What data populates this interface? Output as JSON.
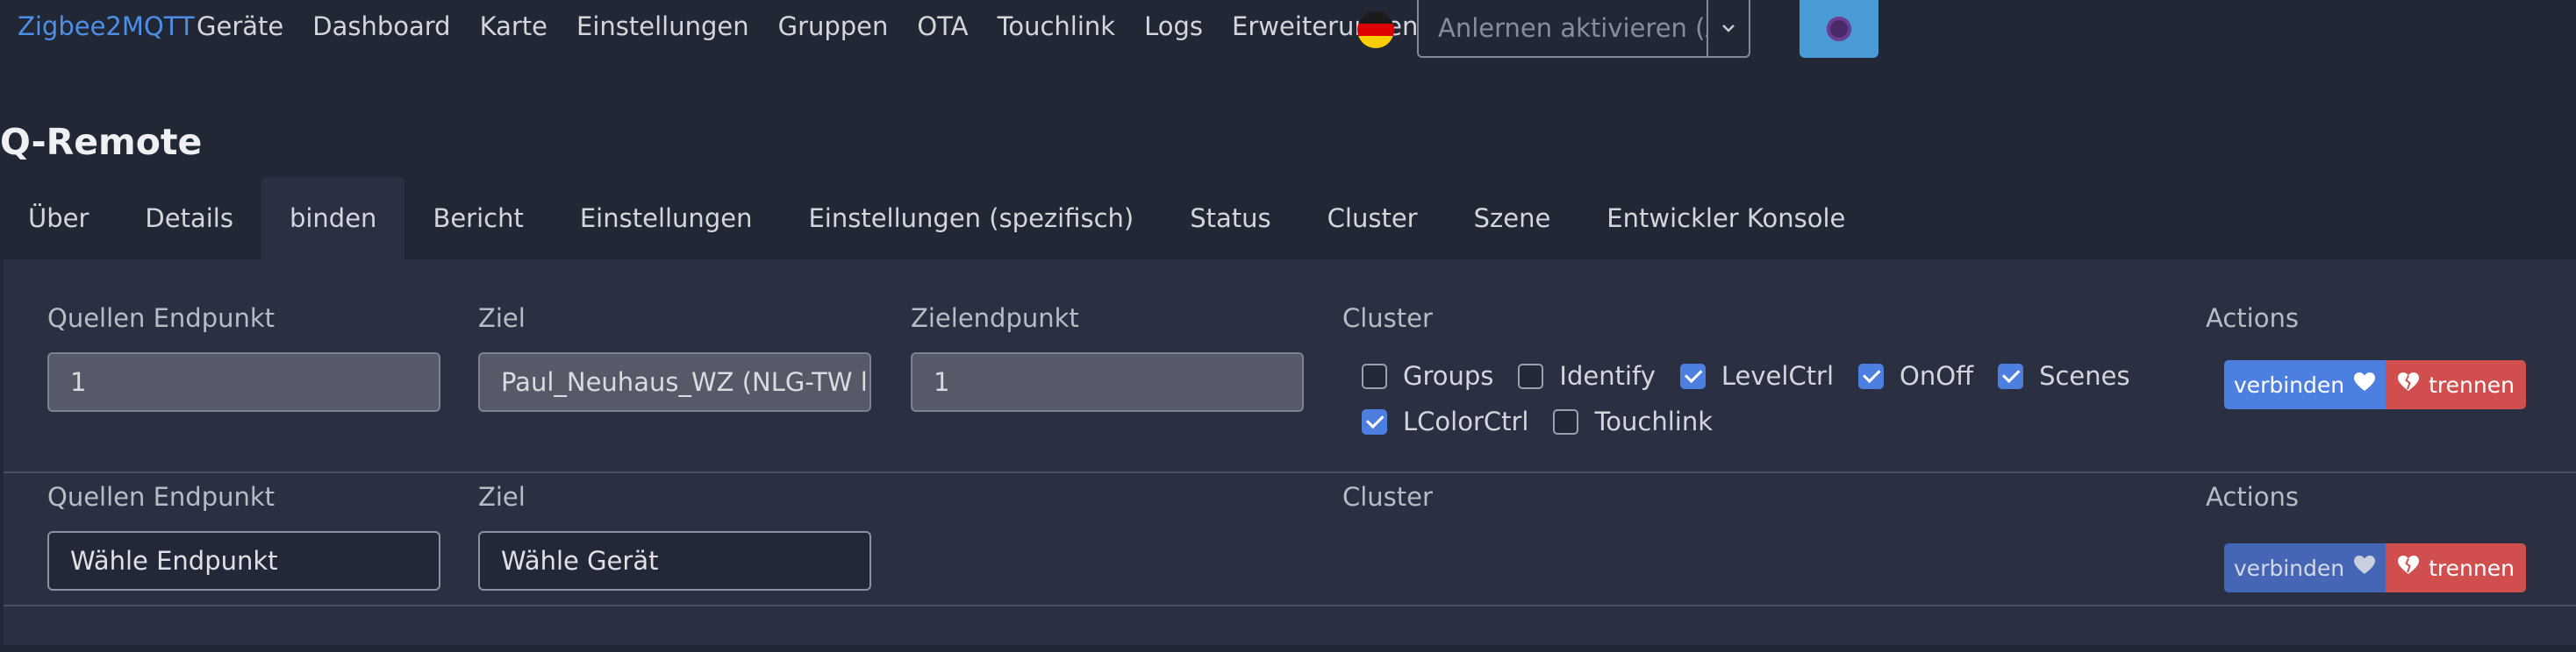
{
  "navbar": {
    "brand": "Zigbee2MQTT",
    "items": [
      "Geräte",
      "Dashboard",
      "Karte",
      "Einstellungen",
      "Gruppen",
      "OTA",
      "Touchlink",
      "Logs",
      "Erweiterungen"
    ],
    "permit_join": "Anlernen aktivieren (Alle)"
  },
  "page": {
    "title": "Q-Remote"
  },
  "tabs": [
    "Über",
    "Details",
    "binden",
    "Bericht",
    "Einstellungen",
    "Einstellungen (spezifisch)",
    "Status",
    "Cluster",
    "Szene",
    "Entwickler Konsole"
  ],
  "active_tab": "binden",
  "labels": {
    "source_endpoint": "Quellen Endpunkt",
    "target": "Ziel",
    "target_endpoint": "Zielendpunkt",
    "cluster": "Cluster",
    "actions": "Actions"
  },
  "buttons": {
    "bind": "verbinden",
    "unbind": "trennen"
  },
  "rows": [
    {
      "source_endpoint": "1",
      "target": "Paul_Neuhaus_WZ (NLG-TW light)",
      "target_endpoint": "1",
      "clusters": [
        {
          "name": "Groups",
          "checked": false
        },
        {
          "name": "Identify",
          "checked": false
        },
        {
          "name": "LevelCtrl",
          "checked": true
        },
        {
          "name": "OnOff",
          "checked": true
        },
        {
          "name": "Scenes",
          "checked": true
        },
        {
          "name": "LColorCtrl",
          "checked": true
        },
        {
          "name": "Touchlink",
          "checked": false
        }
      ]
    },
    {
      "source_endpoint": "Wähle Endpunkt",
      "target": "Wähle Gerät"
    }
  ],
  "colors": {
    "background": "#222736",
    "panel": "#2a2f41",
    "brand": "#4d8fe7",
    "primary": "#4d7fe0",
    "danger": "#d14e4e",
    "info": "#4a9ad6"
  },
  "icons": {
    "bind": "heart-icon",
    "unbind": "broken-heart-icon",
    "flag": "german-flag-icon",
    "theme": "theme-icon"
  }
}
